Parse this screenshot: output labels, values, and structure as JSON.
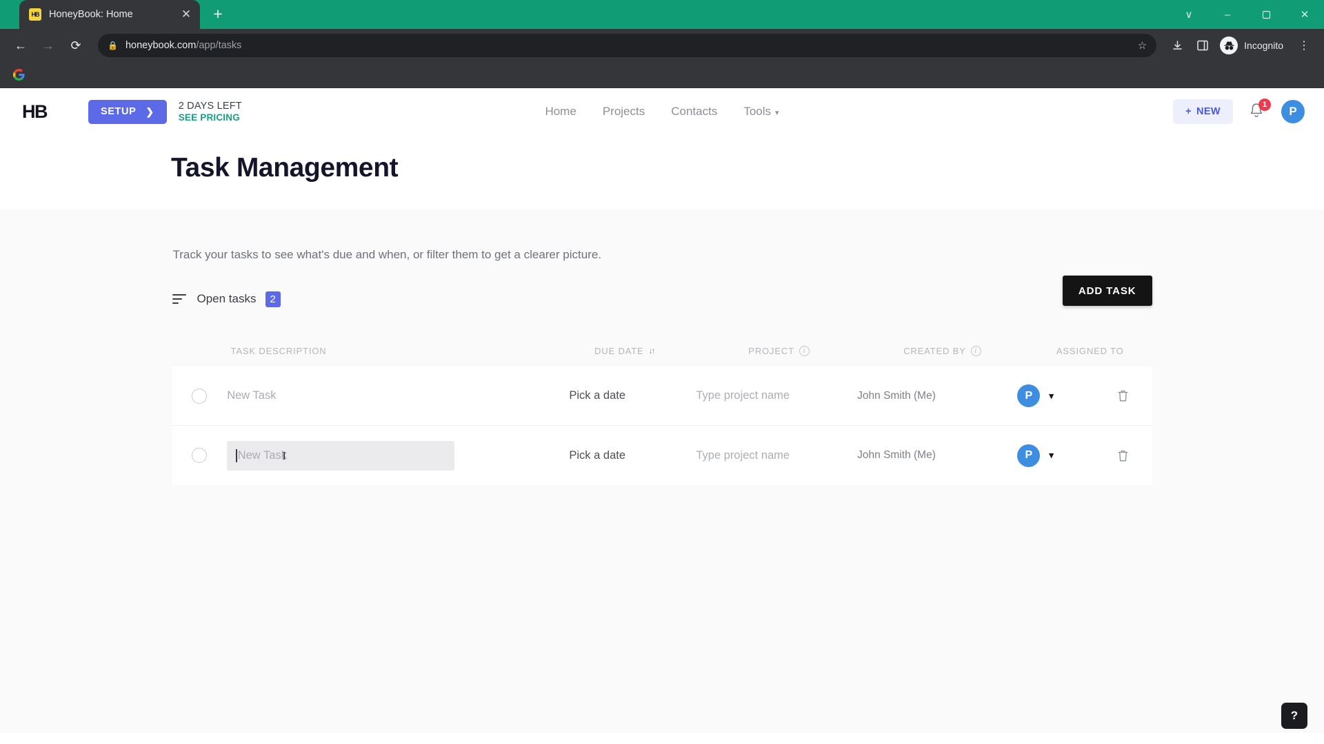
{
  "browser": {
    "tab": {
      "title": "HoneyBook: Home",
      "favicon_text": "HB",
      "close_icon": "close-icon"
    },
    "new_tab_label": "+",
    "window_controls": {
      "collapse": "∨",
      "minimize": "–",
      "maximize": "❐",
      "close": "✕"
    },
    "nav": {
      "back": "←",
      "forward": "→",
      "reload": "⟳"
    },
    "omnibox": {
      "lock_icon": "lock-icon",
      "url_domain": "honeybook.com",
      "url_path": "/app/tasks",
      "star_icon": "☆"
    },
    "toolbar_icons": {
      "download": "download-icon",
      "side_panel": "side-panel-icon",
      "menu": "⋮"
    },
    "profile": {
      "label": "Incognito"
    },
    "bookmarks": [
      {
        "name": "google-bookmark"
      }
    ]
  },
  "app": {
    "logo": "HB",
    "setup_button": {
      "label": "SETUP",
      "chevron": "❯"
    },
    "trial": {
      "days_left": "2 DAYS LEFT",
      "pricing_link": "SEE PRICING"
    },
    "nav_items": [
      {
        "label": "Home"
      },
      {
        "label": "Projects"
      },
      {
        "label": "Contacts"
      },
      {
        "label": "Tools",
        "has_chevron": true
      }
    ],
    "new_button": {
      "plus": "+",
      "label": "NEW"
    },
    "notifications": {
      "count": "1"
    },
    "avatar_initial": "P",
    "colors": {
      "setup_blue": "#5d6ae8",
      "pricing_teal": "#1a9e84",
      "badge_red": "#f0394b",
      "avatar_blue": "#3d8de0",
      "add_task_black": "#141414",
      "browser_green": "#109c74"
    }
  },
  "page": {
    "title": "Task Management",
    "subtitle": "Track your tasks to see what's due and when, or filter them to get a clearer picture.",
    "filter": {
      "icon": "filter-icon",
      "label": "Open tasks",
      "count": "2"
    },
    "add_task_button": "ADD TASK",
    "table": {
      "columns": [
        {
          "label": "TASK DESCRIPTION"
        },
        {
          "label": "DUE DATE",
          "sort_icon": "↓↑"
        },
        {
          "label": "PROJECT",
          "info_icon": "i"
        },
        {
          "label": "CREATED BY",
          "info_icon": "i"
        },
        {
          "label": "ASSIGNED TO"
        }
      ],
      "rows": [
        {
          "description_placeholder": "New Task",
          "due_date": "Pick a date",
          "project_placeholder": "Type project name",
          "created_by": "John Smith (Me)",
          "assigned_initial": "P",
          "focused": false
        },
        {
          "description_placeholder": "New Task",
          "due_date": "Pick a date",
          "project_placeholder": "Type project name",
          "created_by": "John Smith (Me)",
          "assigned_initial": "P",
          "focused": true
        }
      ]
    },
    "help_button": "?"
  }
}
